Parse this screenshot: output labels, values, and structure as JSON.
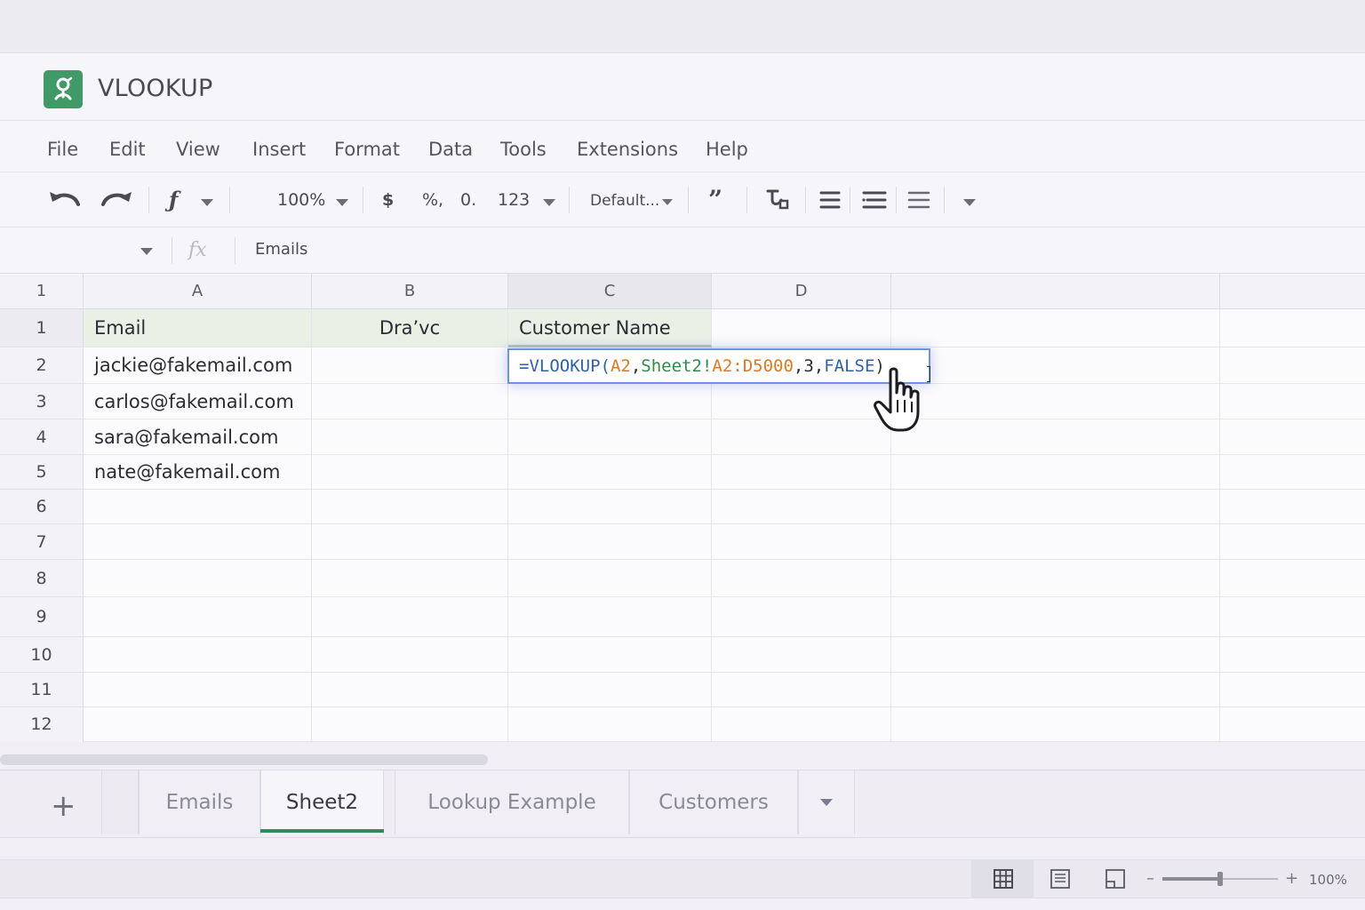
{
  "app": {
    "title": "VLOOKUP",
    "logo": "sheets-logo-icon",
    "brand_color": "#3f9a68"
  },
  "menu": [
    "File",
    "Edit",
    "View",
    "Insert",
    "Format",
    "Data",
    "Tools",
    "Extensions",
    "Help"
  ],
  "toolbar": {
    "zoom": "100%",
    "currency": "$",
    "percent": "%,",
    "decimal": "0.",
    "number_format": "123",
    "font": "Default...",
    "icons": [
      "undo-icon",
      "redo-icon",
      "function-icon",
      "quote-icon",
      "clear-format-icon",
      "align-left-icon",
      "align-center-icon",
      "align-right-icon",
      "more-icon"
    ]
  },
  "formula_bar": {
    "fx": "fx",
    "content": "Emails"
  },
  "grid": {
    "column_headers": [
      "A",
      "B",
      "C",
      "D"
    ],
    "corner_label": "1",
    "row_numbers": [
      "1",
      "2",
      "3",
      "4",
      "5",
      "6",
      "7",
      "8",
      "9",
      "10",
      "11",
      "12"
    ],
    "header_row": [
      "Email",
      "Dra’vc",
      "Customer Name",
      ""
    ],
    "emails": [
      "jackie@fakemail.com",
      "carlos@fakemail.com",
      "sara@fakemail.com",
      "nate@fakemail.com"
    ]
  },
  "formula_editor": {
    "parts": [
      {
        "text": "=VLOOKUP(",
        "color": "#2f5fb0"
      },
      {
        "text": "A2",
        "color": "#e07a1f"
      },
      {
        "text": ",",
        "color": "#2c2c34"
      },
      {
        "text": "Sheet2!",
        "color": "#2e8b4a"
      },
      {
        "text": "A2:D5000",
        "color": "#e07a1f"
      },
      {
        "text": ",3,",
        "color": "#2c2c34"
      },
      {
        "text": "FALSE",
        "color": "#2f5fb0"
      },
      {
        "text": ")",
        "color": "#2c2c34"
      }
    ]
  },
  "sheets": {
    "add": "+",
    "tabs": [
      "Emails",
      "Sheet2",
      "Lookup Example",
      "Customers"
    ],
    "active": "Sheet2",
    "accent": "#2f8a5e"
  },
  "status": {
    "zoom": "100%",
    "zoom_fraction": 0.5,
    "minus": "–",
    "plus": "+"
  }
}
